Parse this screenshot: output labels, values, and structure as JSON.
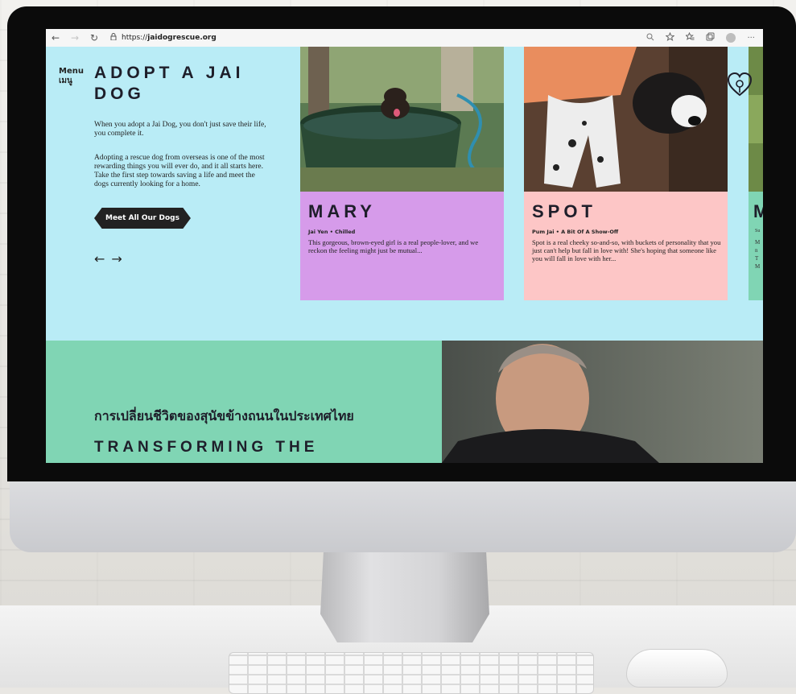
{
  "browser": {
    "url_prefix": "https://",
    "url_host": "jaidogrescue.org",
    "back_icon": "←",
    "forward_icon": "→",
    "reload_icon": "↻",
    "more_icon": "···"
  },
  "header": {
    "menu_en": "Menu",
    "menu_th": "เมนู"
  },
  "hero": {
    "title": "ADOPT A JAI DOG",
    "paragraph1": "When you adopt a Jai Dog, you don't just save their life, you complete it.",
    "paragraph2": "Adopting a rescue dog from overseas is one of the most rewarding things you will ever do, and it all starts here. Take the first step towards saving a life and meet the dogs currently looking for a home.",
    "cta_label": "Meet All Our Dogs",
    "prev_arrow": "←",
    "next_arrow": "→"
  },
  "dogs": [
    {
      "name": "MARY",
      "tag": "Jai Yen • Chilled",
      "description": "This gorgeous, brown-eyed girl is a real people-lover, and we reckon the feeling might just be mutual...",
      "color": "#d69bea"
    },
    {
      "name": "SPOT",
      "tag": "Pum Jai • A Bit Of A Show-Off",
      "description": "Spot is a real cheeky so-and-so, with buckets of personality that you just can't help but fall in love with! She's hoping that someone like you will fall in love with her...",
      "color": "#fdc6c6"
    },
    {
      "name": "M",
      "tag": "Su",
      "description": "M n T M",
      "color": "#80d5b4"
    }
  ],
  "section2": {
    "thai_heading": "การเปลี่ยนชีวิตของสุนัขข้างถนนในประเทศไทย",
    "heading": "TRANSFORMING THE"
  },
  "colors": {
    "hero_bg": "#b9ecf6",
    "mary_card": "#d69bea",
    "spot_card": "#fdc6c6",
    "mint": "#80d5b4",
    "dark_text": "#1e1e2a"
  }
}
